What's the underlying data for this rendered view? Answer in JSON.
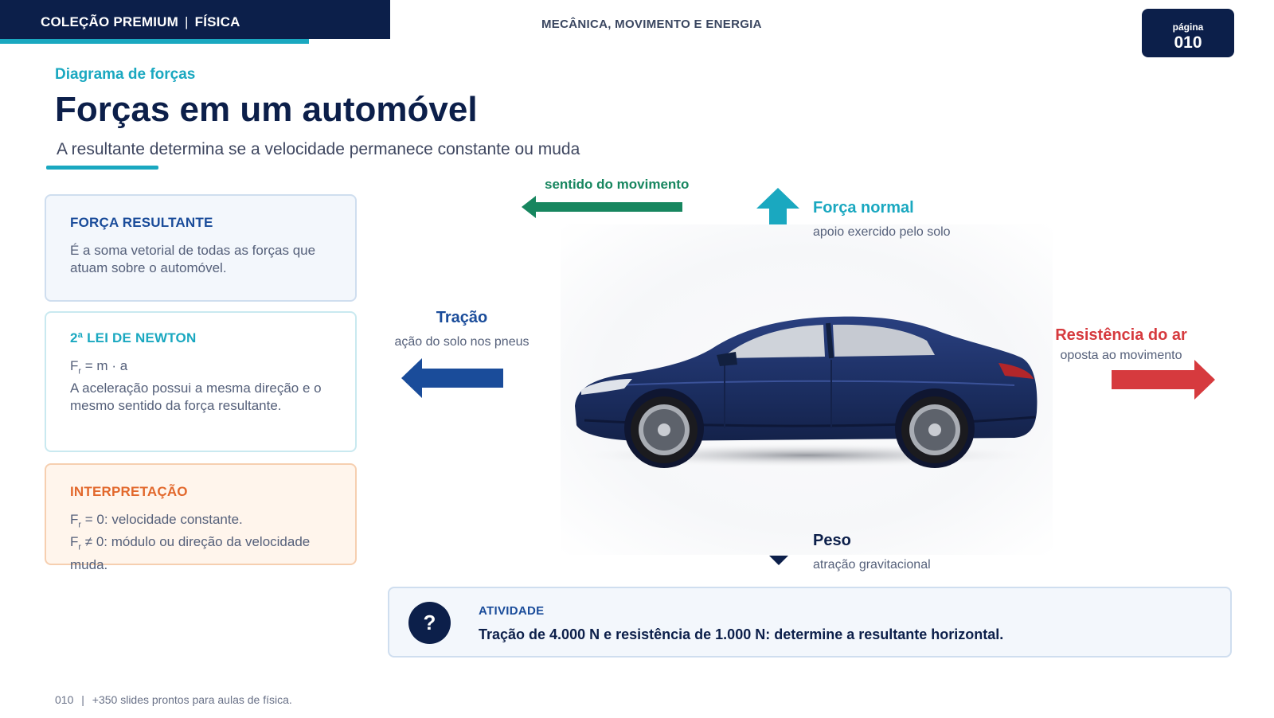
{
  "header": {
    "collection": "COLEÇÃO PREMIUM",
    "separator": "|",
    "subject": "FÍSICA",
    "topic": "MECÂNICA, MOVIMENTO E ENERGIA",
    "page_label": "página",
    "page_number": "010"
  },
  "title_block": {
    "kicker": "Diagrama de forças",
    "title": "Forças em um automóvel",
    "subtitle": "A resultante determina se a velocidade permanece constante ou muda"
  },
  "cards": [
    {
      "title": "FORÇA RESULTANTE",
      "text": "É a soma vetorial de todas as forças que atuam sobre o automóvel."
    },
    {
      "title": "2ª LEI DE NEWTON",
      "formula_main": "F",
      "formula_sub": "r",
      "formula_rest": " = m · a",
      "text": "A aceleração possui a mesma direção e o mesmo sentido da força resultante."
    },
    {
      "title": "INTERPRETAÇÃO",
      "line1_main": "F",
      "line1_sub": "r",
      "line1_rest": " = 0: velocidade constante.",
      "line2_main": "F",
      "line2_sub": "r",
      "line2_rest": " ≠ 0: módulo ou direção da velocidade muda."
    }
  ],
  "diagram": {
    "motion_label": "sentido do movimento",
    "normal_title": "Força normal",
    "normal_desc": "apoio exercido pelo solo",
    "traction_title": "Tração",
    "traction_desc": "ação do solo nos pneus",
    "air_title": "Resistência do ar",
    "air_desc": "oposta ao movimento",
    "weight_title": "Peso",
    "weight_desc": "atração gravitacional",
    "colors": {
      "motion": "#17865f",
      "normal": "#1aa8c0",
      "traction": "#1a4c9a",
      "air": "#d63a3e",
      "weight": "#0c1f4a",
      "car_body": "#1c2f63"
    }
  },
  "activity": {
    "icon": "?",
    "title": "ATIVIDADE",
    "text": "Tração de 4.000 N e resistência de 1.000 N: determine a resultante horizontal."
  },
  "footer": {
    "page": "010",
    "separator": "|",
    "text": "+350 slides prontos para aulas de física."
  }
}
